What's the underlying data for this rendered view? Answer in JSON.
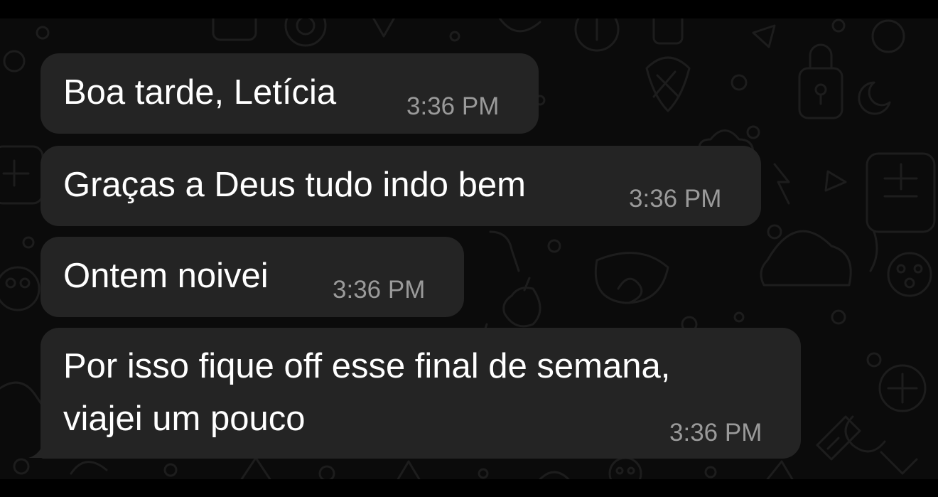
{
  "chat": {
    "messages": [
      {
        "text": "Boa tarde, Letícia",
        "time": "3:36 PM"
      },
      {
        "text": "Graças a Deus tudo indo bem",
        "time": "3:36 PM"
      },
      {
        "text": "Ontem noivei",
        "time": "3:36 PM"
      },
      {
        "text_lines": [
          "Por isso fique off esse final de semana,",
          "viajei um pouco"
        ],
        "time": "3:36 PM"
      }
    ]
  },
  "colors": {
    "background": "#0b0b0b",
    "bubble": "#242424",
    "message_text": "#ffffff",
    "timestamp": "#9a9a9a",
    "doodle": "#1d1d1d"
  },
  "icons": [
    "chat-wallpaper-doodle-pattern"
  ]
}
